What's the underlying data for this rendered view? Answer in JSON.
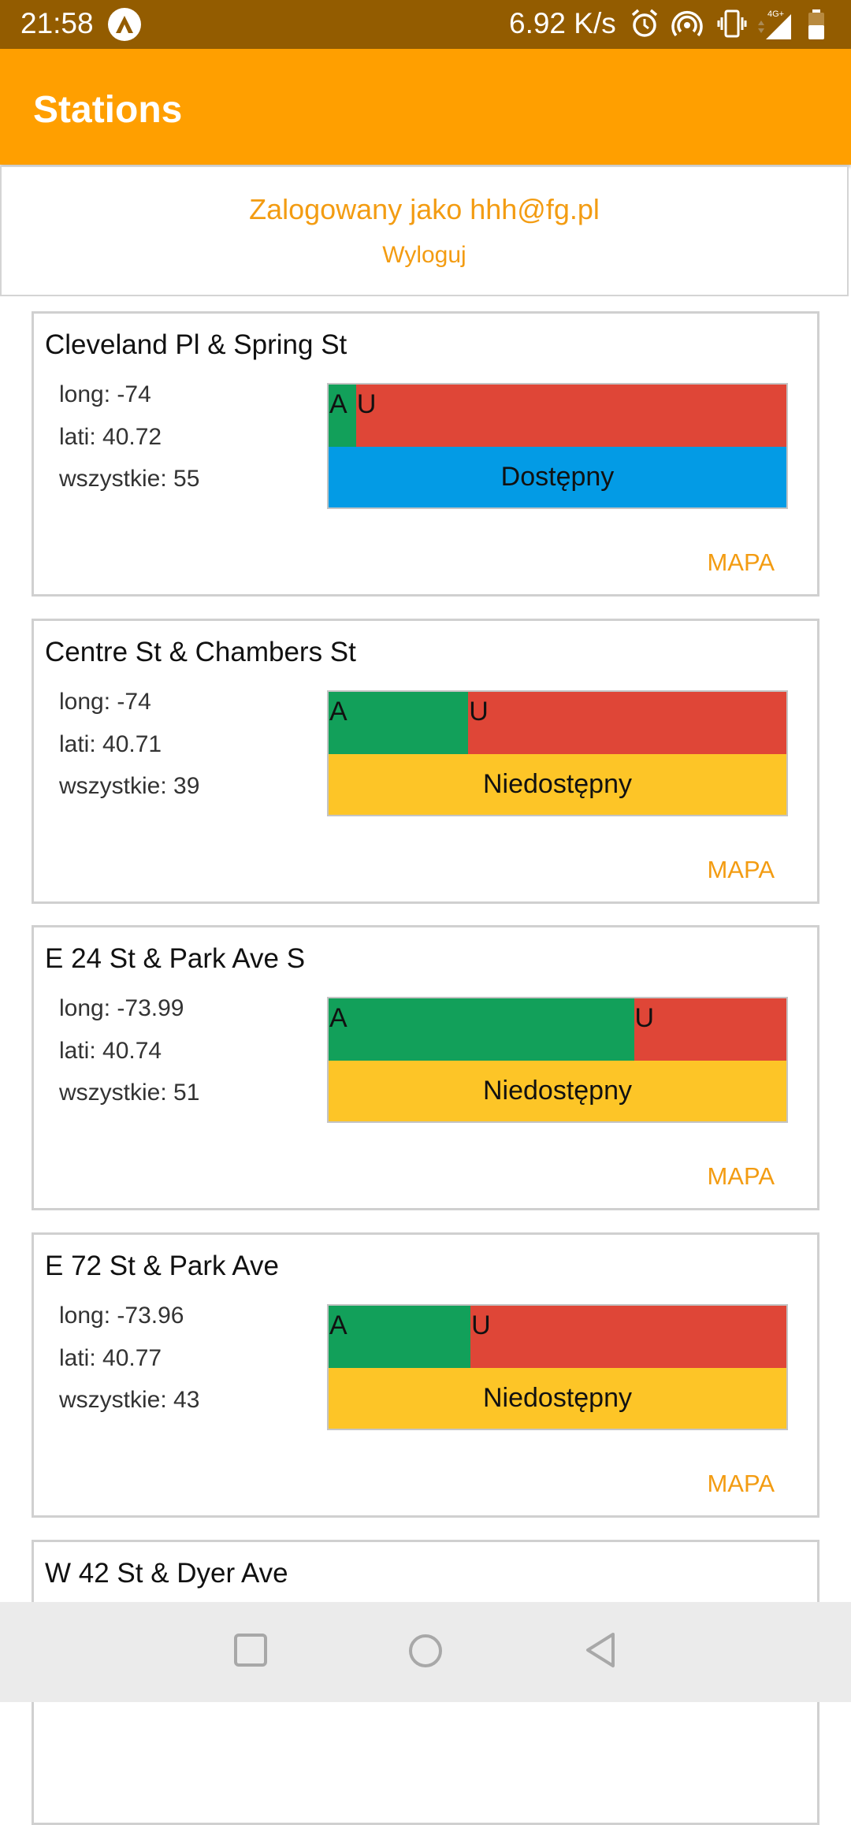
{
  "status_bar": {
    "time": "21:58",
    "network_speed": "6.92 K/s",
    "icons": [
      "app-a-icon",
      "alarm-icon",
      "hotspot-icon",
      "vibrate-icon",
      "signal-4g-icon",
      "battery-icon"
    ]
  },
  "app_bar": {
    "title": "Stations"
  },
  "login": {
    "logged_in_text": "Zalogowany jako hhh@fg.pl",
    "logout_label": "Wyloguj"
  },
  "colors": {
    "status_bar": "#935c00",
    "app_bar": "#ff9f00",
    "accent": "#f39c12",
    "available_segment": "#12a05a",
    "unavailable_segment": "#df4637",
    "status_available": "#039be5",
    "status_unavailable": "#fdc527"
  },
  "stations": [
    {
      "name": "Cleveland Pl & Spring St",
      "long": "long: -74",
      "lati": "lati: 40.72",
      "total": "wszystkie: 55",
      "available_fraction": 0.06,
      "a_label": "A",
      "u_label": "U",
      "status": "Dostępny",
      "status_color": "#039be5",
      "map_label": "MAPA"
    },
    {
      "name": "Centre St & Chambers St",
      "long": "long: -74",
      "lati": "lati: 40.71",
      "total": "wszystkie: 39",
      "available_fraction": 0.305,
      "a_label": "A",
      "u_label": "U",
      "status": "Niedostępny",
      "status_color": "#fdc527",
      "map_label": "MAPA"
    },
    {
      "name": "E 24 St & Park Ave S",
      "long": "long: -73.99",
      "lati": "lati: 40.74",
      "total": "wszystkie: 51",
      "available_fraction": 0.667,
      "a_label": "A",
      "u_label": "U",
      "status": "Niedostępny",
      "status_color": "#fdc527",
      "map_label": "MAPA"
    },
    {
      "name": "E 72 St & Park Ave",
      "long": "long: -73.96",
      "lati": "lati: 40.77",
      "total": "wszystkie: 43",
      "available_fraction": 0.31,
      "a_label": "A",
      "u_label": "U",
      "status": "Niedostępny",
      "status_color": "#fdc527",
      "map_label": "MAPA"
    },
    {
      "name": "W 42 St & Dyer Ave"
    }
  ],
  "nav_bar": {
    "icons": [
      "recents-square-icon",
      "home-circle-icon",
      "back-triangle-icon"
    ]
  }
}
